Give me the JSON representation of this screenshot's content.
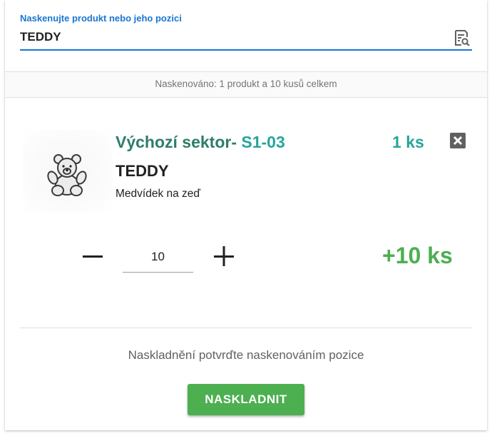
{
  "search": {
    "label": "Naskenujte produkt nebo jeho pozici",
    "value": "TEDDY",
    "icon": "scan-search-icon"
  },
  "summary": {
    "text": "Naskenováno: 1 produkt a 10 kusů celkem"
  },
  "product": {
    "image_icon": "teddy-bear-image",
    "sector_label": "Výchozí sektor-",
    "sector_code": "S1-03",
    "stock_qty": "1 ks",
    "code": "TEDDY",
    "name": "Medvídek na zeď",
    "remove_icon": "close-icon"
  },
  "quantity": {
    "minus_icon": "minus-icon",
    "value": "10",
    "plus_icon": "plus-icon",
    "delta": "+10 ks"
  },
  "footer": {
    "hint": "Naskladnění potvrďte naskenováním pozice",
    "submit_label": "NASKLADNIT"
  },
  "colors": {
    "accent_blue": "#1976d2",
    "sector_green": "#2e7d6a",
    "teal": "#26a69a",
    "success_green": "#4caf50"
  }
}
